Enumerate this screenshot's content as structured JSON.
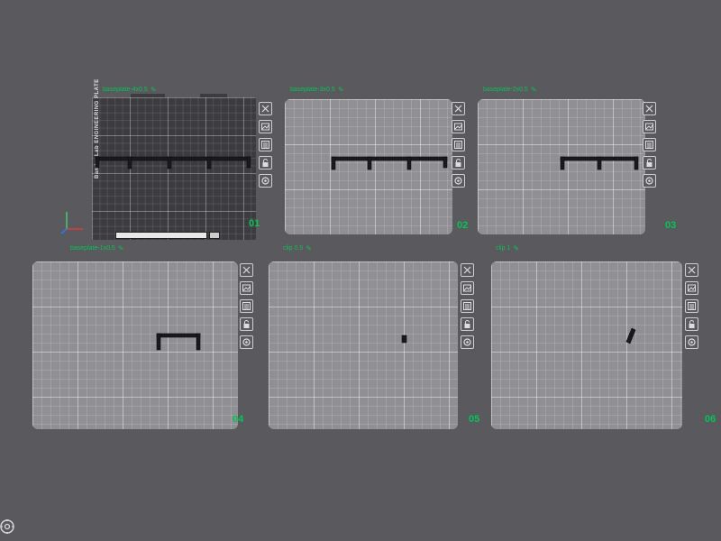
{
  "colors": {
    "background": "#59595e",
    "label": "#00c853",
    "plate": "#8f8f94",
    "active_plate": "#3c3c40",
    "object": "#1e1e20"
  },
  "plates": [
    {
      "name": "baseplate-4x0.5",
      "number": "01",
      "active": true
    },
    {
      "name": "baseplate-3x0.5",
      "number": "02",
      "active": false
    },
    {
      "name": "baseplate-2x0.5",
      "number": "03",
      "active": false
    },
    {
      "name": "baseplate-1x0.5",
      "number": "04",
      "active": false
    },
    {
      "name": "clip 0.5",
      "number": "05",
      "active": false
    },
    {
      "name": "clip 1",
      "number": "06",
      "active": false
    }
  ],
  "plate_icons": [
    "close-icon",
    "arrange-icon",
    "orient-icon",
    "lock-icon",
    "settings-icon"
  ],
  "active_plate_brand": "Bambu Lab ENGINEERING PLATE",
  "corner_icon": "view-settings-icon"
}
